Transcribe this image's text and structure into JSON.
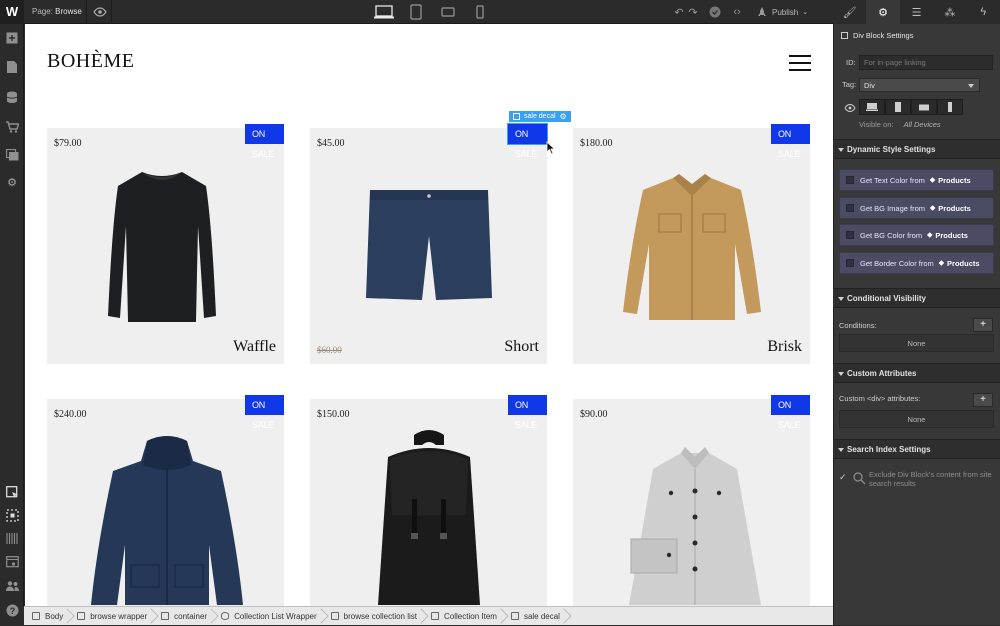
{
  "topbar": {
    "logo": "W",
    "page_label": "Page:",
    "page_name": "Browse",
    "publish_label": "Publish"
  },
  "canvas": {
    "brand": "BOHÈME",
    "products": [
      {
        "price": "$79.00",
        "name": "Waffle",
        "badge": "ON SALE",
        "old_price": ""
      },
      {
        "price": "$45.00",
        "name": "Short",
        "badge": "ON SALE",
        "old_price": "$60.00"
      },
      {
        "price": "$180.00",
        "name": "Brisk",
        "badge": "ON SALE",
        "old_price": ""
      },
      {
        "price": "$240.00",
        "name": "",
        "badge": "ON SALE",
        "old_price": ""
      },
      {
        "price": "$150.00",
        "name": "",
        "badge": "ON SALE",
        "old_price": ""
      },
      {
        "price": "$90.00",
        "name": "",
        "badge": "ON SALE",
        "old_price": ""
      }
    ],
    "selection_tag": "sale decal"
  },
  "breadcrumbs": [
    "Body",
    "browse wrapper",
    "container",
    "Collection List Wrapper",
    "browse collection list",
    "Collection Item",
    "sale decal"
  ],
  "panel": {
    "element_title": "Div Block Settings",
    "id_label": "ID:",
    "id_placeholder": "For in-page linking",
    "tag_label": "Tag:",
    "tag_value": "Div",
    "visible_on_label": "Visible on:",
    "visible_on_value": "All Devices",
    "dynamic_section": "Dynamic Style Settings",
    "dynamic_items": [
      {
        "label": "Get Text Color from",
        "source": "Products"
      },
      {
        "label": "Get BG Image from",
        "source": "Products"
      },
      {
        "label": "Get BG Color from",
        "source": "Products"
      },
      {
        "label": "Get Border Color from",
        "source": "Products"
      }
    ],
    "conditional_section": "Conditional Visibility",
    "conditions_label": "Conditions:",
    "conditions_value": "None",
    "attributes_section": "Custom Attributes",
    "attributes_label": "Custom <div> attributes:",
    "attributes_value": "None",
    "search_section": "Search Index Settings",
    "search_option": "Exclude Div Block's content from site search results"
  },
  "colors": {
    "sale_badge": "#1138e8",
    "selection": "#3aa0f0",
    "dynamic_item_bg": "#4b4b63"
  }
}
